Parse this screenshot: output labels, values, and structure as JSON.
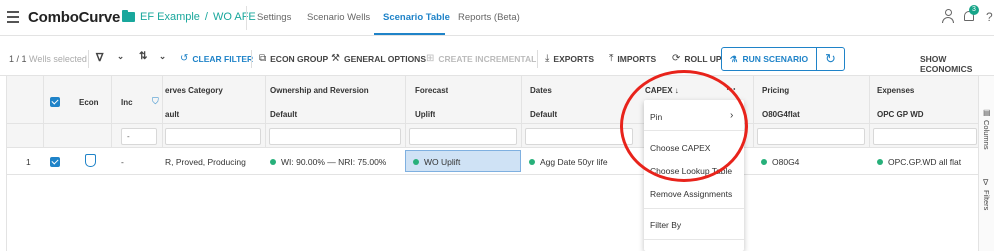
{
  "header": {
    "app_name": "ComboCurve",
    "breadcrumb": {
      "project": "EF Example",
      "separator": "/",
      "scenario": "WO AFE"
    },
    "tabs": [
      {
        "label": "Settings"
      },
      {
        "label": "Scenario Wells"
      },
      {
        "label": "Scenario Table",
        "active": true
      },
      {
        "label": "Reports (Beta)"
      }
    ],
    "notification_count": "3",
    "help_icon": "?"
  },
  "toolbar": {
    "selection_count": "1 / 1",
    "selection_label": "Wells selected",
    "clear_filter": "CLEAR FILTER",
    "econ_group": "ECON GROUP",
    "general_options": "GENERAL OPTIONS",
    "create_incremental": "CREATE INCREMENTAL",
    "exports": "EXPORTS",
    "imports": "IMPORTS",
    "roll_up": "ROLL UP",
    "run_scenario": "RUN SCENARIO",
    "show_economics": "SHOW ECONOMICS"
  },
  "grid": {
    "columns": [
      {
        "key": "econ",
        "header": "Econ",
        "sub": ""
      },
      {
        "key": "inc",
        "header": "Inc",
        "sub": ""
      },
      {
        "key": "reserves",
        "header": "erves Category",
        "sub": "ault"
      },
      {
        "key": "ownership",
        "header": "Ownership and Reversion",
        "sub": "Default"
      },
      {
        "key": "forecast",
        "header": "Forecast",
        "sub": "Uplift"
      },
      {
        "key": "dates",
        "header": "Dates",
        "sub": "Default"
      },
      {
        "key": "capex",
        "header": "CAPEX",
        "sub": ""
      },
      {
        "key": "pricing",
        "header": "Pricing",
        "sub": "O80G4flat"
      },
      {
        "key": "expenses",
        "header": "Expenses",
        "sub": "OPC GP WD"
      }
    ],
    "inc_filter": "-",
    "rows": [
      {
        "index": "1",
        "inc": "-",
        "reserves": "R, Proved, Producing",
        "ownership": "WI: 90.00% — NRI: 75.00%",
        "forecast": "WO Uplift",
        "dates": "Agg Date 50yr life",
        "pricing": "O80G4",
        "expenses": "OPC.GP.WD all flat"
      }
    ]
  },
  "capex_menu": {
    "items": [
      "Pin",
      "Choose CAPEX",
      "Choose Lookup Table",
      "Remove Assignments",
      "Filter By"
    ]
  },
  "side_panel": {
    "columns": "Columns",
    "filters": "Filters"
  },
  "colors": {
    "accent": "#1f83c8",
    "brand_green": "#19a79c",
    "status_green": "#27b07a",
    "highlight_ring": "#e8231b"
  }
}
